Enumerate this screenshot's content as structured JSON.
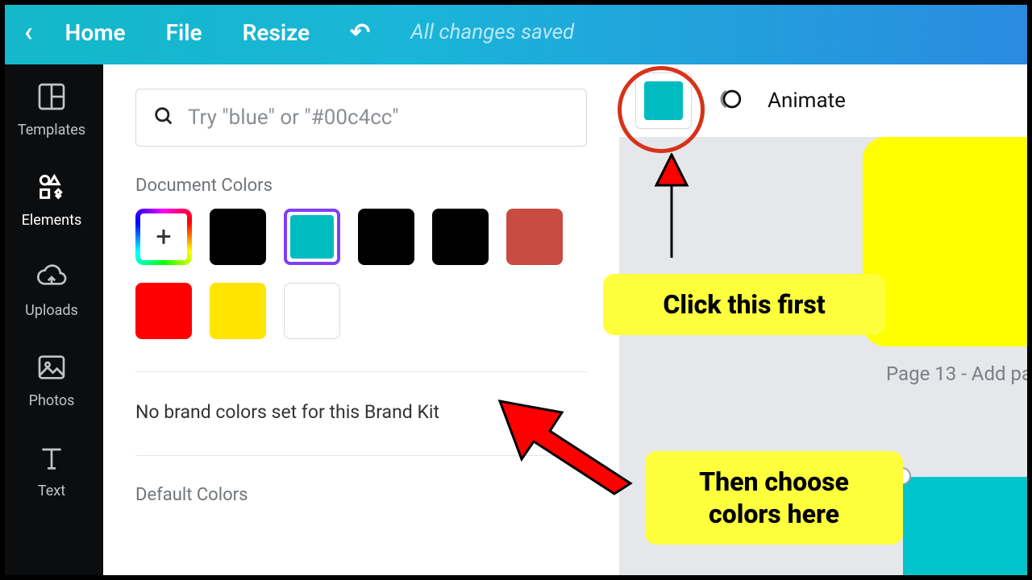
{
  "topbar": {
    "home": "Home",
    "file": "File",
    "resize": "Resize",
    "status": "All changes saved"
  },
  "sidebar": {
    "templates": "Templates",
    "elements": "Elements",
    "uploads": "Uploads",
    "photos": "Photos",
    "text": "Text"
  },
  "panel": {
    "search_placeholder": "Try \"blue\" or \"#00c4cc\"",
    "doc_colors_title": "Document Colors",
    "brand_msg": "No brand colors set for this Brand Kit",
    "default_title": "Default Colors",
    "swatches": {
      "c0_add": "+",
      "c1": "#000000",
      "c2": "#00bcc1",
      "c3": "#000000",
      "c4": "#000000",
      "c5": "#c94b42",
      "c6": "#ff0000",
      "c7": "#ffe400",
      "c8": "#ffffff"
    }
  },
  "context": {
    "color": "#00bcc1",
    "animate": "Animate"
  },
  "canvas": {
    "page_label": "Page 13 - Add pa"
  },
  "annotations": {
    "callout1": "Click this first",
    "callout2": "Then choose colors here"
  }
}
